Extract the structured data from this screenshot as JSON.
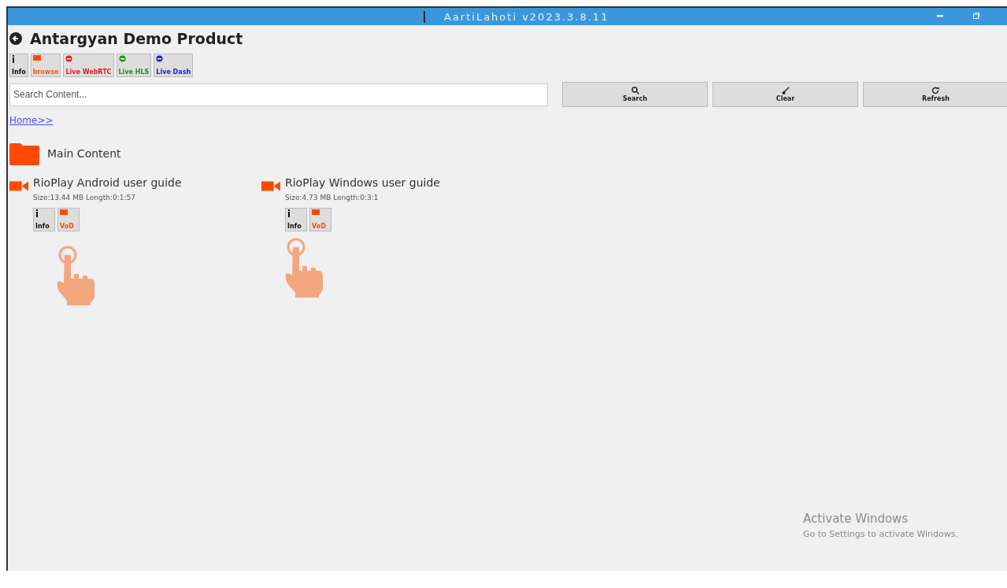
{
  "window": {
    "title": "AartiLahoti v2023.3.8.11"
  },
  "header": {
    "title": "Antargyan Demo Product"
  },
  "toolbar": [
    {
      "label": "Info",
      "kind": "info"
    },
    {
      "label": "browse",
      "kind": "browse"
    },
    {
      "label": "Live WebRTC",
      "kind": "live",
      "color": "#e02020"
    },
    {
      "label": "Live HLS",
      "kind": "live",
      "color": "#1a9a1a"
    },
    {
      "label": "Live Dash",
      "kind": "live",
      "color": "#2020e0"
    }
  ],
  "search": {
    "placeholder": "Search Content..."
  },
  "actions": [
    {
      "label": "Search",
      "kind": "search"
    },
    {
      "label": "Clear",
      "kind": "clear"
    },
    {
      "label": "Refresh",
      "kind": "refresh"
    }
  ],
  "breadcrumb": "Home>>",
  "folder": {
    "name": "Main Content"
  },
  "videos": [
    {
      "title": "RioPlay Android user guide",
      "meta": "Size:13.44 MB Length:0:1:57",
      "buttons": [
        "Info",
        "VoD"
      ]
    },
    {
      "title": "RioPlay Windows user guide",
      "meta": "Size:4.73 MB Length:0:3:1",
      "buttons": [
        "Info",
        "VoD"
      ]
    }
  ],
  "notice": {
    "title": "Activate Windows",
    "text": "Go to Settings to activate Windows."
  }
}
